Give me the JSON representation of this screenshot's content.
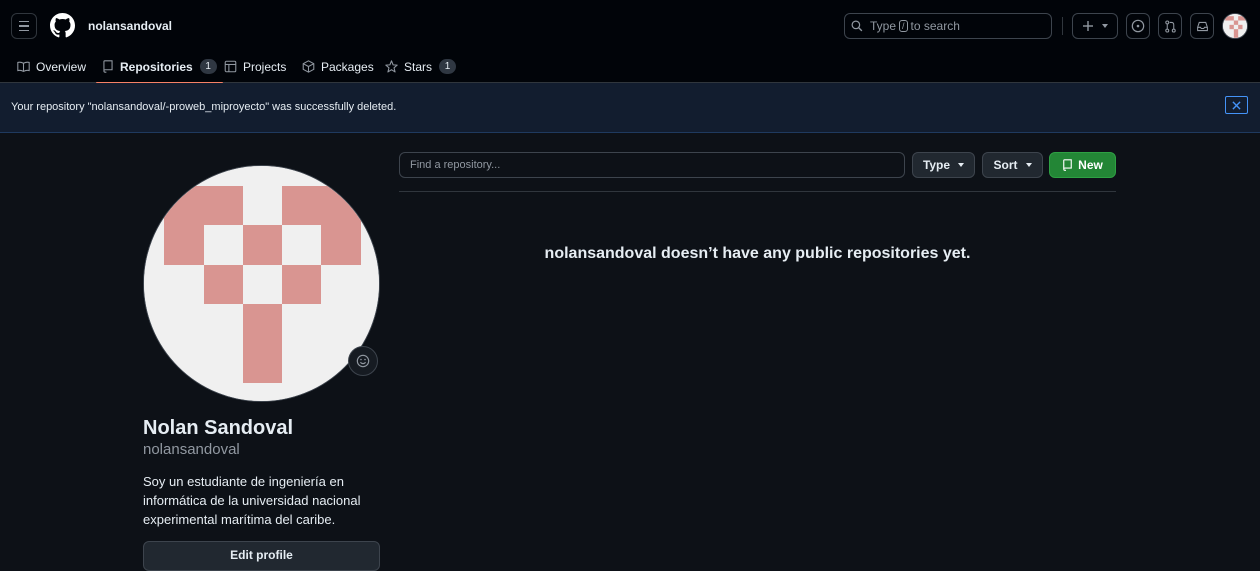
{
  "header": {
    "username": "nolansandoval",
    "search_placeholder_pre": "Type",
    "search_key": "/",
    "search_placeholder_post": "to search"
  },
  "tabs": [
    {
      "label": "Overview",
      "icon": "book-icon"
    },
    {
      "label": "Repositories",
      "icon": "repo-icon",
      "count": "1",
      "active": true
    },
    {
      "label": "Projects",
      "icon": "table-icon"
    },
    {
      "label": "Packages",
      "icon": "package-icon"
    },
    {
      "label": "Stars",
      "icon": "star-icon",
      "count": "1"
    }
  ],
  "flash": {
    "message": "Your repository \"nolansandoval/-proweb_miproyecto\" was successfully deleted."
  },
  "profile": {
    "name": "Nolan Sandoval",
    "login": "nolansandoval",
    "bio": "Soy un estudiante de ingeniería en informática de la universidad nacional experimental marítima del caribe.",
    "edit_label": "Edit profile"
  },
  "repos": {
    "find_placeholder": "Find a repository...",
    "type_label": "Type",
    "sort_label": "Sort",
    "new_label": "New",
    "empty_message": "nolansandoval doesn’t have any public repositories yet."
  },
  "colors": {
    "accent_tab": "#f78166",
    "new_button": "#238636",
    "identicon": "#d99591"
  }
}
